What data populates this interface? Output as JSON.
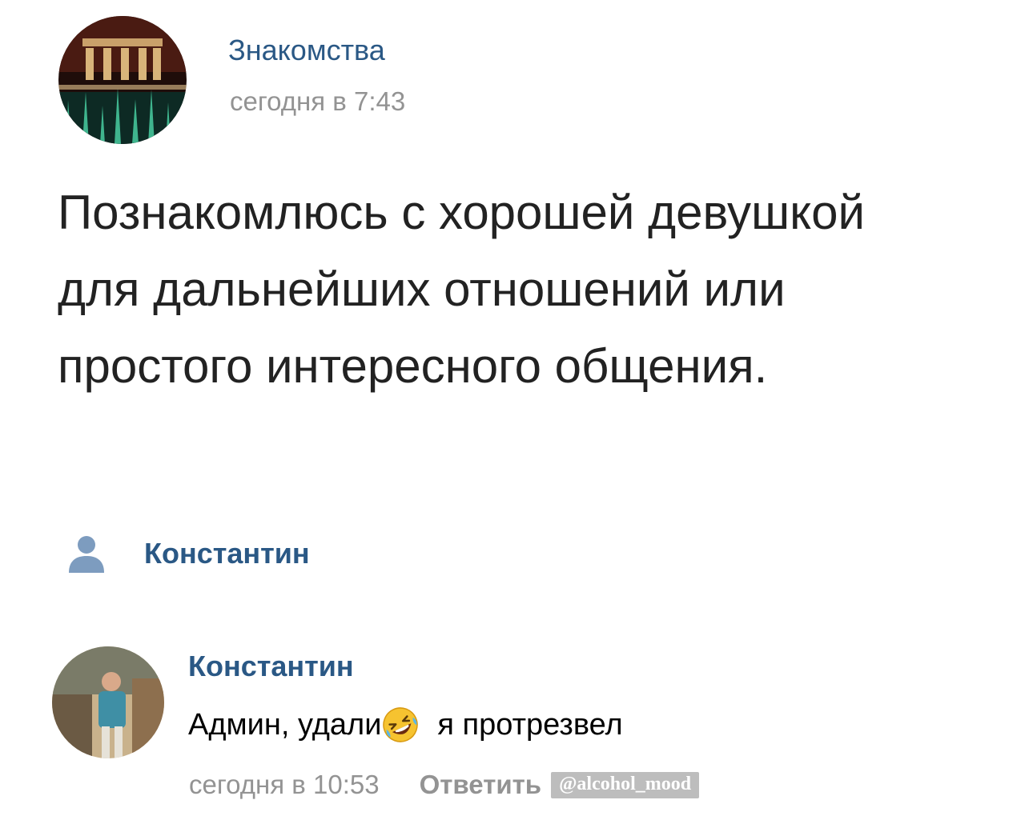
{
  "post": {
    "group_name": "Знакомства",
    "time": "сегодня в 7:43",
    "text": "Познакомлюсь с хорошей девушкой для дальнейших отношений или простого интересного общения.",
    "signer_name": "Константин"
  },
  "comment": {
    "author": "Константин",
    "text_before": "Админ, удали",
    "emoji": "rolling-on-floor-laughing",
    "text_after": "я протрезвел",
    "time": "сегодня в 10:53",
    "reply_label": "Ответить"
  },
  "watermark": "@alcohol_mood",
  "colors": {
    "link": "#2a5885",
    "meta": "#939393",
    "text": "#222222",
    "watermark_bg": "#bdbdbd"
  },
  "icons": {
    "signer": "user-icon",
    "emoji": "laughing-emoji-icon"
  }
}
